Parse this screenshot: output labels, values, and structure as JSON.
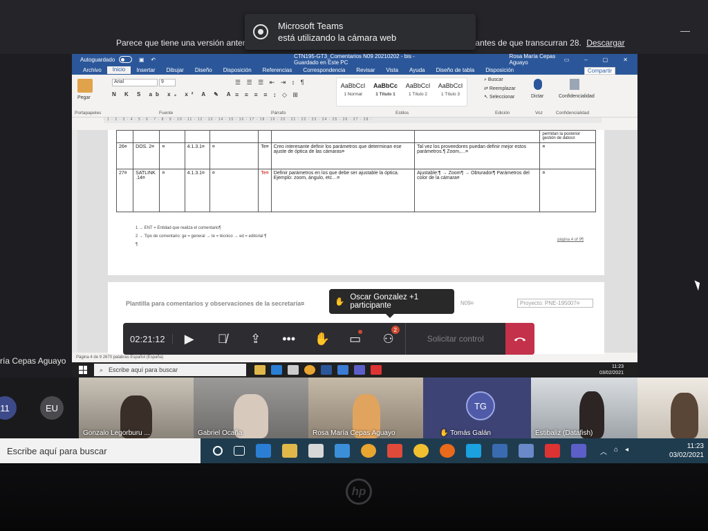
{
  "notification": {
    "title": "Microsoft Teams",
    "message": "está utilizando la cámara web"
  },
  "outer_notice": {
    "text": "Parece que tiene una versión anterior de Teams. Para continuar usando la aplicación, actualícela antes de que transcurran 28.",
    "link": "Descargar"
  },
  "presenter_name_partial": "ría Cepas Aguayo",
  "word": {
    "autosave_label": "Autoguardado",
    "doc_title": "CTN195-GT3_Comentarios N09 20210202 - bis  -  Guardado en Este PC",
    "user": "Rosa María Cepas Aguayo",
    "tabs": [
      "Archivo",
      "Inicio",
      "Insertar",
      "Dibujar",
      "Diseño",
      "Disposición",
      "Referencias",
      "Correspondencia",
      "Revisar",
      "Vista",
      "Ayuda",
      "Diseño de tabla",
      "Disposición"
    ],
    "share": "Compartir",
    "ribbon": {
      "paste": "Pegar",
      "clipboard": "Portapapeles",
      "font_name": "Arial",
      "font_size": "9",
      "font_group": "Fuente",
      "paragraph_group": "Párrafo",
      "styles_group": "Estilos",
      "edit_group": "Edición",
      "voice_group": "Voz",
      "confidentiality_group": "Confidencialidad",
      "styles": [
        {
          "preview": "AaBbCcI",
          "name": "1 Normal"
        },
        {
          "preview": "AaBbCc",
          "name": "1 Título 1"
        },
        {
          "preview": "AaBbCcI",
          "name": "1 Título 2"
        },
        {
          "preview": "AaBbCcI",
          "name": "1 Título 3"
        }
      ],
      "find": "Buscar",
      "replace": "Reemplazar",
      "select": "Seleccionar",
      "dictate": "Dictar",
      "confidentiality": "Confidencialidad"
    },
    "table_rows": [
      {
        "n": "",
        "ent": "",
        "c1": "",
        "c2": "",
        "c3": "",
        "type": "",
        "comment": "",
        "proposal": "",
        "obs": "permitan la posterior gestión de datos¤"
      },
      {
        "n": "26¤",
        "ent": "DOS. 2¤",
        "c1": "¤",
        "c2": "4.1.3.1¤",
        "c3": "¤",
        "type": "Te¤",
        "comment": "Creo interesante definir los parámetros que determinan ese ajuste de óptica de las cámaras¤",
        "proposal": "Tal vez los proveedores puedan definir mejor estos parámetros.¶ Zoom,…¤",
        "obs": "¤"
      },
      {
        "n": "27¤",
        "ent": "SATLINK .14¤",
        "c1": "¤",
        "c2": "4.1.3.1¤",
        "c3": "¤",
        "type": "Te¤",
        "comment": "Definir parámetros en los que debe ser ajustable la óptica. Ejemplo: zoom, ángulo, etc…¤",
        "proposal": "Ajustable:¶ → Zoom¶ → Obturador¶ Parámetros del color de la cámara¤",
        "obs": "¤"
      }
    ],
    "footnote_1": "1 → ENT = Entidad que realiza el comentario¶",
    "footnote_2": "2 → Tipo de comentario: ge = general → te = técnico → ed = editorial ¶",
    "pilcrow": "¶",
    "page_number": "página 4 of 9¶",
    "page2_title": "Plantilla para comentarios y observaciones de la secretaría¤",
    "page2_n": "N09¤",
    "page2_project": "Proyecto: PNE-195007¤",
    "status": "Página 4 de 9    2670 palabras    Español (España)",
    "remote_search": "Escribe aquí para buscar",
    "remote_time": "11:23",
    "remote_date": "03/02/2021"
  },
  "meeting": {
    "raise_hand_tooltip": "Oscar Gonzalez +1 participante",
    "timer": "02:21:12",
    "participants_badge": "2",
    "request_control": "Solicitar control"
  },
  "participants": [
    {
      "initials": "11"
    },
    {
      "initials": "EU"
    },
    {
      "name": "Gonzalo Legorburu ..."
    },
    {
      "name": "Gabriel Ocaña"
    },
    {
      "name": "Rosa María Cepas Aguayo"
    },
    {
      "name": "Tomás Galán",
      "initials": "TG"
    },
    {
      "name": "Estibaliz (Datafish)"
    }
  ],
  "taskbar": {
    "search_placeholder": "Escribe aquí para buscar",
    "time": "11:23",
    "date": "03/02/2021"
  },
  "colors": {
    "word_blue": "#2b579a",
    "teams_bar": "#2d2c31",
    "hangup_red": "#c4314b",
    "badge_red": "#cc4a31",
    "taskbar_blue": "#1f3c4f"
  }
}
